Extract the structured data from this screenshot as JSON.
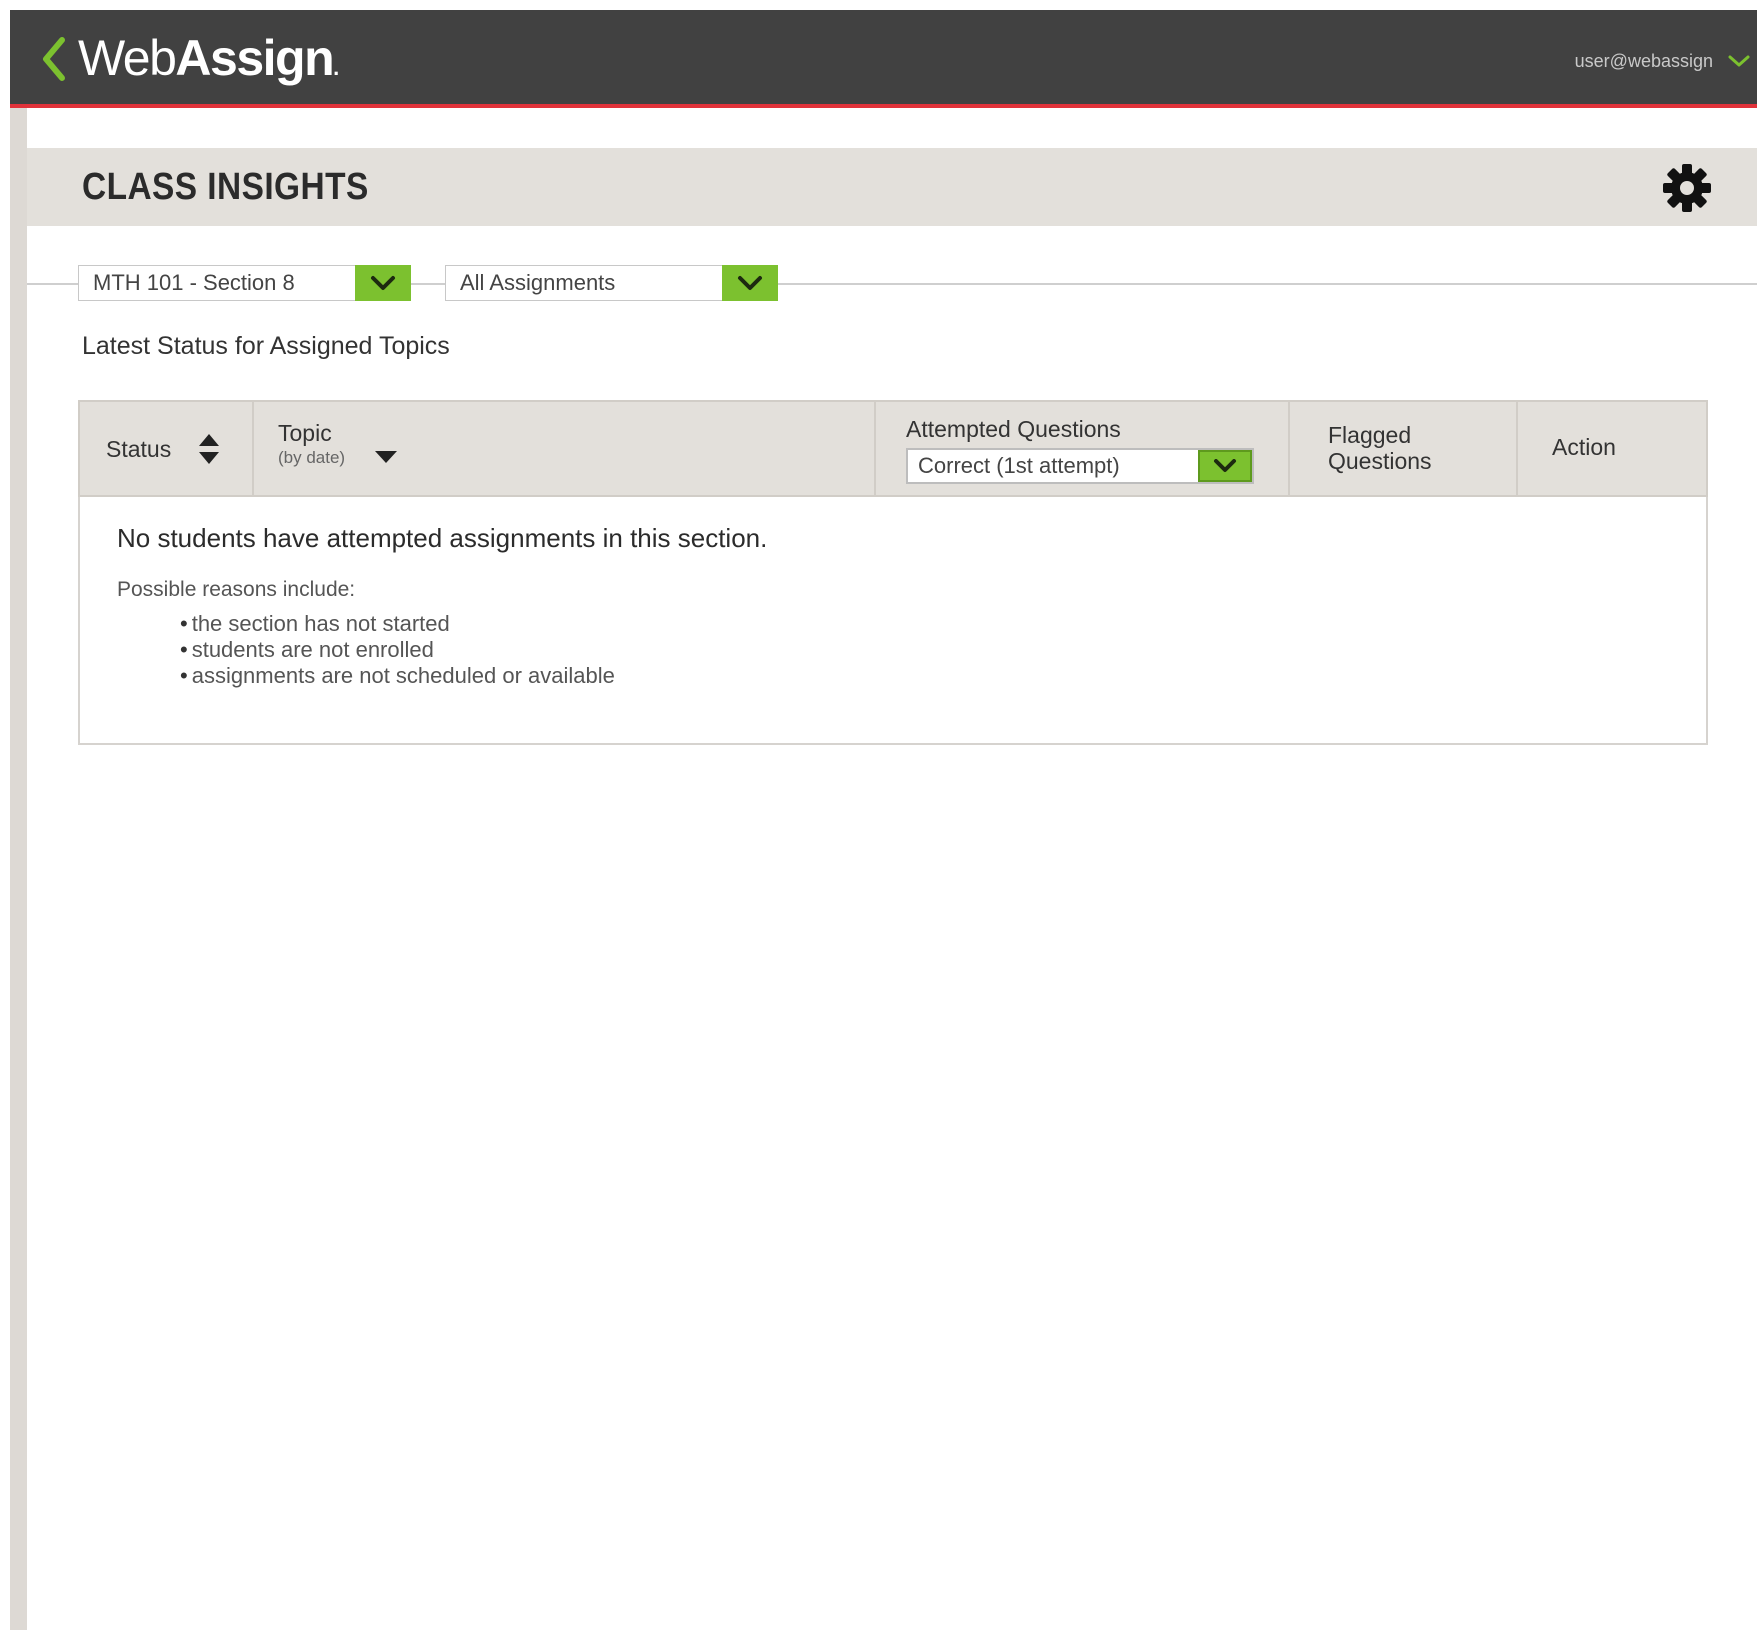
{
  "topbar": {
    "logo_light": "Web",
    "logo_bold": "Assign",
    "logo_dot": ".",
    "user": "user@webassign",
    "accent_color": "#7cc12f",
    "rule_color": "#e0323a"
  },
  "header": {
    "title": "CLASS INSIGHTS"
  },
  "filters": {
    "section": "MTH 101 - Section 8",
    "assignments": "All Assignments"
  },
  "subtitle": "Latest Status for Assigned Topics",
  "table": {
    "columns": {
      "status": "Status",
      "topic": "Topic",
      "topic_sub": "(by date)",
      "attempted": "Attempted Questions",
      "attempted_filter": "Correct (1st attempt)",
      "flagged_line1": "Flagged",
      "flagged_line2": "Questions",
      "action": "Action"
    },
    "empty_message": "No students have attempted assignments in this section.",
    "reasons_label": "Possible reasons include:",
    "reasons": [
      "the section has not started",
      "students are not enrolled",
      "assignments are not scheduled or available"
    ]
  },
  "icons": [
    "back-chevron-icon",
    "chevron-down-icon",
    "gear-icon",
    "sort-updown-icon",
    "sort-down-icon"
  ]
}
